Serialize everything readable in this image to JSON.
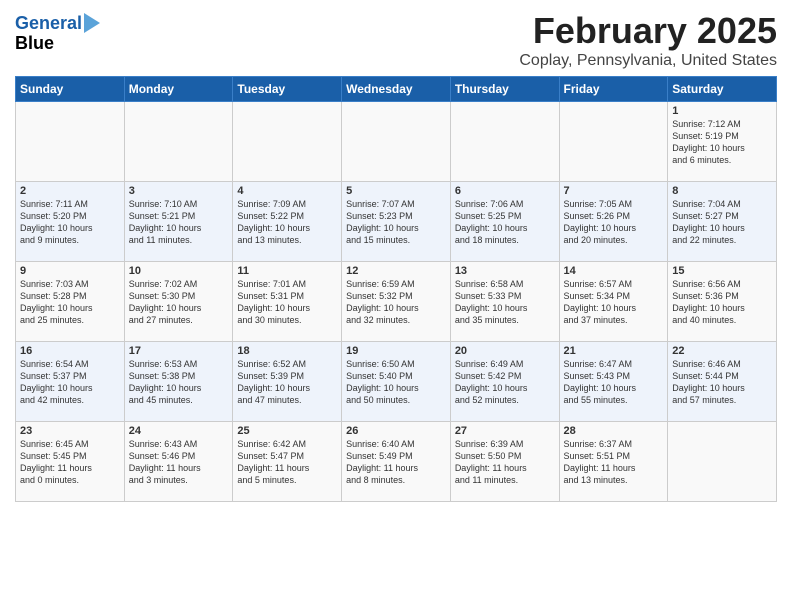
{
  "header": {
    "logo_line1": "General",
    "logo_line2": "Blue",
    "title": "February 2025",
    "subtitle": "Coplay, Pennsylvania, United States"
  },
  "weekdays": [
    "Sunday",
    "Monday",
    "Tuesday",
    "Wednesday",
    "Thursday",
    "Friday",
    "Saturday"
  ],
  "weeks": [
    [
      {
        "day": "",
        "info": ""
      },
      {
        "day": "",
        "info": ""
      },
      {
        "day": "",
        "info": ""
      },
      {
        "day": "",
        "info": ""
      },
      {
        "day": "",
        "info": ""
      },
      {
        "day": "",
        "info": ""
      },
      {
        "day": "1",
        "info": "Sunrise: 7:12 AM\nSunset: 5:19 PM\nDaylight: 10 hours\nand 6 minutes."
      }
    ],
    [
      {
        "day": "2",
        "info": "Sunrise: 7:11 AM\nSunset: 5:20 PM\nDaylight: 10 hours\nand 9 minutes."
      },
      {
        "day": "3",
        "info": "Sunrise: 7:10 AM\nSunset: 5:21 PM\nDaylight: 10 hours\nand 11 minutes."
      },
      {
        "day": "4",
        "info": "Sunrise: 7:09 AM\nSunset: 5:22 PM\nDaylight: 10 hours\nand 13 minutes."
      },
      {
        "day": "5",
        "info": "Sunrise: 7:07 AM\nSunset: 5:23 PM\nDaylight: 10 hours\nand 15 minutes."
      },
      {
        "day": "6",
        "info": "Sunrise: 7:06 AM\nSunset: 5:25 PM\nDaylight: 10 hours\nand 18 minutes."
      },
      {
        "day": "7",
        "info": "Sunrise: 7:05 AM\nSunset: 5:26 PM\nDaylight: 10 hours\nand 20 minutes."
      },
      {
        "day": "8",
        "info": "Sunrise: 7:04 AM\nSunset: 5:27 PM\nDaylight: 10 hours\nand 22 minutes."
      }
    ],
    [
      {
        "day": "9",
        "info": "Sunrise: 7:03 AM\nSunset: 5:28 PM\nDaylight: 10 hours\nand 25 minutes."
      },
      {
        "day": "10",
        "info": "Sunrise: 7:02 AM\nSunset: 5:30 PM\nDaylight: 10 hours\nand 27 minutes."
      },
      {
        "day": "11",
        "info": "Sunrise: 7:01 AM\nSunset: 5:31 PM\nDaylight: 10 hours\nand 30 minutes."
      },
      {
        "day": "12",
        "info": "Sunrise: 6:59 AM\nSunset: 5:32 PM\nDaylight: 10 hours\nand 32 minutes."
      },
      {
        "day": "13",
        "info": "Sunrise: 6:58 AM\nSunset: 5:33 PM\nDaylight: 10 hours\nand 35 minutes."
      },
      {
        "day": "14",
        "info": "Sunrise: 6:57 AM\nSunset: 5:34 PM\nDaylight: 10 hours\nand 37 minutes."
      },
      {
        "day": "15",
        "info": "Sunrise: 6:56 AM\nSunset: 5:36 PM\nDaylight: 10 hours\nand 40 minutes."
      }
    ],
    [
      {
        "day": "16",
        "info": "Sunrise: 6:54 AM\nSunset: 5:37 PM\nDaylight: 10 hours\nand 42 minutes."
      },
      {
        "day": "17",
        "info": "Sunrise: 6:53 AM\nSunset: 5:38 PM\nDaylight: 10 hours\nand 45 minutes."
      },
      {
        "day": "18",
        "info": "Sunrise: 6:52 AM\nSunset: 5:39 PM\nDaylight: 10 hours\nand 47 minutes."
      },
      {
        "day": "19",
        "info": "Sunrise: 6:50 AM\nSunset: 5:40 PM\nDaylight: 10 hours\nand 50 minutes."
      },
      {
        "day": "20",
        "info": "Sunrise: 6:49 AM\nSunset: 5:42 PM\nDaylight: 10 hours\nand 52 minutes."
      },
      {
        "day": "21",
        "info": "Sunrise: 6:47 AM\nSunset: 5:43 PM\nDaylight: 10 hours\nand 55 minutes."
      },
      {
        "day": "22",
        "info": "Sunrise: 6:46 AM\nSunset: 5:44 PM\nDaylight: 10 hours\nand 57 minutes."
      }
    ],
    [
      {
        "day": "23",
        "info": "Sunrise: 6:45 AM\nSunset: 5:45 PM\nDaylight: 11 hours\nand 0 minutes."
      },
      {
        "day": "24",
        "info": "Sunrise: 6:43 AM\nSunset: 5:46 PM\nDaylight: 11 hours\nand 3 minutes."
      },
      {
        "day": "25",
        "info": "Sunrise: 6:42 AM\nSunset: 5:47 PM\nDaylight: 11 hours\nand 5 minutes."
      },
      {
        "day": "26",
        "info": "Sunrise: 6:40 AM\nSunset: 5:49 PM\nDaylight: 11 hours\nand 8 minutes."
      },
      {
        "day": "27",
        "info": "Sunrise: 6:39 AM\nSunset: 5:50 PM\nDaylight: 11 hours\nand 11 minutes."
      },
      {
        "day": "28",
        "info": "Sunrise: 6:37 AM\nSunset: 5:51 PM\nDaylight: 11 hours\nand 13 minutes."
      },
      {
        "day": "",
        "info": ""
      }
    ]
  ]
}
